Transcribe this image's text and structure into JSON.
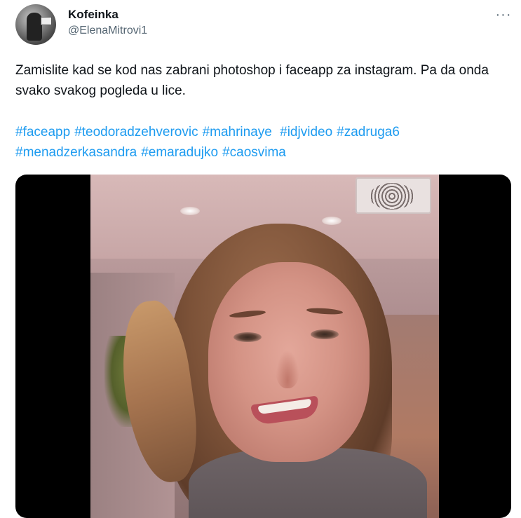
{
  "author": {
    "display_name": "Kofeinka",
    "handle": "@ElenaMitrovi1",
    "avatar_icon": "profile-photo"
  },
  "menu": {
    "more_icon": "more-options-icon",
    "more_glyph": "···"
  },
  "tweet": {
    "text": "Zamislite kad se kod nas zabrani photoshop i faceapp za instagram. Pa da onda svako svakog pogleda u lice.",
    "hashtags": [
      "#faceapp",
      "#teodoradzehverovic",
      "#mahrinaye",
      "#idjvideo",
      "#zadruga6",
      "#menadzerkasandra",
      "#emaradujko",
      "#caosvima"
    ]
  },
  "colors": {
    "text_primary": "#0f1419",
    "text_secondary": "#536471",
    "hashtag": "#1d9bf0",
    "media_background": "#000000"
  }
}
